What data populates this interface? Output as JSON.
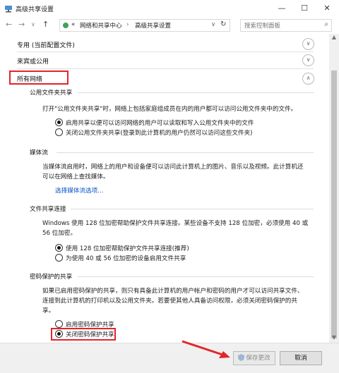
{
  "window": {
    "title": "高级共享设置",
    "minimize": "—",
    "maximize": "☐",
    "close": "✕"
  },
  "address": {
    "crumbs": [
      "«",
      "网络和共享中心",
      "›",
      "高级共享设置"
    ],
    "search_placeholder": "搜索控制面板"
  },
  "profiles": [
    {
      "label": "专用 (当前配置文件)",
      "expanded": false
    },
    {
      "label": "来宾或公用",
      "expanded": false
    },
    {
      "label": "所有网络",
      "expanded": true
    }
  ],
  "public_folder": {
    "heading": "公用文件夹共享",
    "description": "打开\"公用文件夹共享\"时，网络上包括家庭组成员在内的用户都可以访问公用文件夹中的文件。",
    "options": [
      {
        "label": "启用共享以便可以访问网络的用户可以读取和写入公用文件夹中的文件",
        "selected": true
      },
      {
        "label": "关闭公用文件夹共享(登录到此计算机的用户仍然可以访问这些文件夹)",
        "selected": false
      }
    ]
  },
  "media": {
    "heading": "媒体流",
    "description_1": "当媒体流启用时，网络上的用户和设备便可以访问此计算机上的图片、音乐以及视频。此计算机还",
    "description_2": "可以在网络上查找媒体。",
    "link": "选择媒体流选项..."
  },
  "file_sharing": {
    "heading": "文件共享连接",
    "description_1": "Windows 使用 128 位加密帮助保护文件共享连接。某些设备不支持 128 位加密，必须使用 40 或",
    "description_2": "56 位加密。",
    "options": [
      {
        "label": "使用 128 位加密帮助保护文件共享连接(推荐)",
        "selected": true
      },
      {
        "label": "为使用 40 或 56 位加密的设备启用文件共享",
        "selected": false
      }
    ]
  },
  "password": {
    "heading": "密码保护的共享",
    "description_1": "如果已启用密码保护的共享，则只有具备此计算机的用户帐户和密码的用户才可以访问共享文件、",
    "description_2": "连接到此计算机的打印机以及公用文件夹。若要使其他人具备访问权限，必须关闭密码保护的共",
    "description_3": "享。",
    "options": [
      {
        "label": "启用密码保护共享",
        "selected": false
      },
      {
        "label": "关闭密码保护共享",
        "selected": true
      }
    ]
  },
  "footer": {
    "save": "保存更改",
    "cancel": "取消"
  },
  "colors": {
    "highlight": "#e3242b",
    "link": "#0a55c8"
  },
  "icons": {
    "window": "network-icon",
    "shield": "uac-shield-icon"
  }
}
